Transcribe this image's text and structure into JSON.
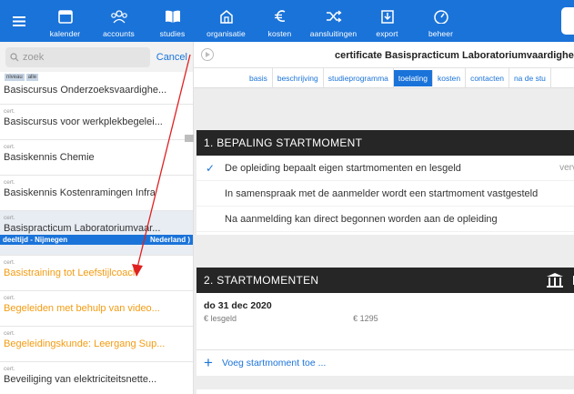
{
  "nav": {
    "items": [
      {
        "label": "kalender",
        "icon": "calendar-icon"
      },
      {
        "label": "accounts",
        "icon": "people-icon"
      },
      {
        "label": "studies",
        "icon": "book-icon"
      },
      {
        "label": "organisatie",
        "icon": "building-icon"
      },
      {
        "label": "kosten",
        "icon": "euro-icon"
      },
      {
        "label": "aansluitingen",
        "icon": "shuffle-icon"
      },
      {
        "label": "export",
        "icon": "export-icon"
      },
      {
        "label": "beheer",
        "icon": "gauge-icon"
      }
    ]
  },
  "search": {
    "placeholder": "zoek",
    "cancel_label": "Cancel"
  },
  "filters": [
    "niveau",
    "alle"
  ],
  "list": {
    "first_partial": "Basiscursus Onderzoeksvaardighe...",
    "items": [
      {
        "tag": "cert.",
        "name": "Basiscursus voor werkplekbegelei..."
      },
      {
        "tag": "cert.",
        "name": "Basiskennis Chemie"
      },
      {
        "tag": "cert.",
        "name": "Basiskennis Kostenramingen Infra"
      },
      {
        "tag": "cert.",
        "name": "Basispracticum Laboratoriumvaar...",
        "sub_left": "deeltijd - Nijmegen",
        "sub_right": "Nederland )"
      },
      {
        "tag": "cert.",
        "name": "Basistraining tot Leefstijlcoach"
      },
      {
        "tag": "cert.",
        "name": "Begeleiden met behulp van video..."
      },
      {
        "tag": "cert.",
        "name": "Begeleidingskunde: Leergang Sup..."
      },
      {
        "tag": "cert.",
        "name": "Beveiliging van elektriciteitsnette..."
      }
    ]
  },
  "detail": {
    "title": "certificate Basispracticum Laboratoriumvaardighed",
    "tabs": [
      "basis",
      "beschrijving",
      "studieprogramma",
      "toelating",
      "kosten",
      "contacten",
      "na de stu"
    ],
    "active_tab": "toelating",
    "section1": {
      "heading": "1. BEPALING STARTMOMENT",
      "options": [
        {
          "text": "De opleiding bepaalt eigen startmomenten en lesgeld",
          "checked": true,
          "trailing": "verv"
        },
        {
          "text": "In samenspraak met de aanmelder wordt een startmoment vastgesteld",
          "checked": false
        },
        {
          "text": "Na aanmelding kan direct begonnen worden aan de opleiding",
          "checked": false
        }
      ]
    },
    "section2": {
      "heading": "2. STARTMOMENTEN",
      "date": "do 31 dec 2020",
      "fee_label": "lesgeld",
      "fee_currency": "€",
      "fee_value": "€ 1295",
      "add_label": "Voeg startmoment toe ..."
    }
  },
  "colors": {
    "accent": "#1a73d9",
    "highlight": "#f39c12",
    "dark_header": "#262626",
    "annotation_arrow": "#e02020"
  }
}
